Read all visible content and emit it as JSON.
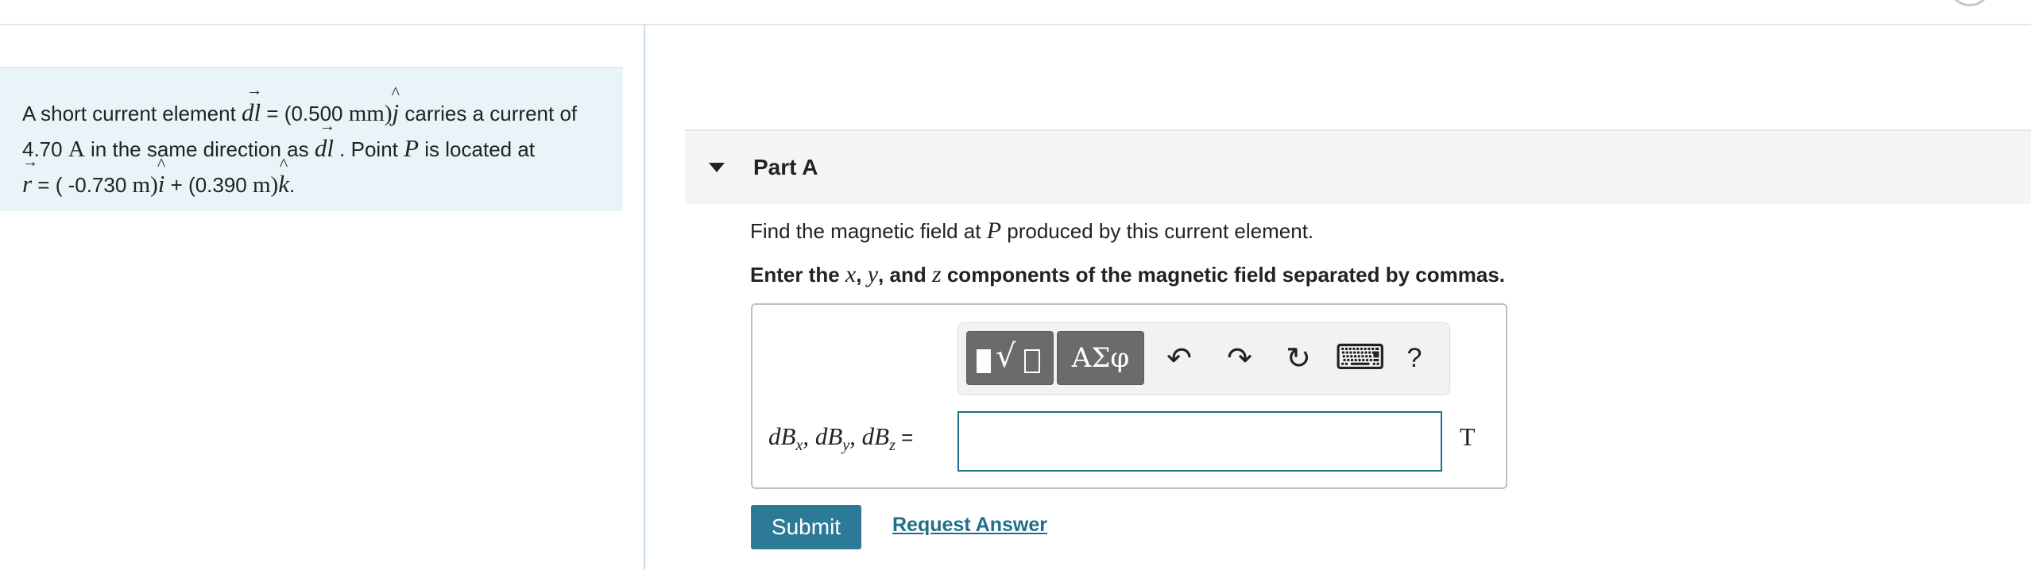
{
  "problem": {
    "text_1": "A short current element ",
    "dl_symbol": "dl",
    "text_2": " = (0.500 ",
    "unit_mm": "mm",
    "text_3": ")",
    "unit_vec_j": "j",
    "text_4": " carries a current of",
    "current_value": "4.70 ",
    "unit_A": "A",
    "text_5": " in the same direction as ",
    "text_6": " . Point ",
    "point_P": "P",
    "text_7": " is located at",
    "r_symbol": "r",
    "text_8": " = ( -0.730 ",
    "unit_m": "m",
    "text_9": ")",
    "unit_vec_i": "i",
    "text_10": " + (0.390 ",
    "text_11": ")",
    "unit_vec_k": "k",
    "text_12": "."
  },
  "part": {
    "title": "Part A",
    "prompt_1": "Find the magnetic field at ",
    "prompt_P": "P",
    "prompt_2": " produced by this current element.",
    "instruction_1": "Enter the ",
    "x": "x",
    "sep_1": ", ",
    "y": "y",
    "sep_2": ", and ",
    "z": "z",
    "instruction_2": " components of the magnetic field separated by commas."
  },
  "toolbar": {
    "templates_icon": "templates-icon",
    "greek_label": "ΑΣφ",
    "undo_icon": "↶",
    "redo_icon": "↷",
    "reset_icon": "↻",
    "keyboard_icon": "⌨",
    "help_label": "?"
  },
  "answer": {
    "label": "dBₓ, dB_y, dB_z",
    "label_dBx": "dBx",
    "label_dBy": "dBy",
    "label_dBz": "dBz",
    "equals": " =",
    "value": "",
    "units_label": "T"
  },
  "actions": {
    "submit_label": "Submit",
    "request_label": "Request Answer"
  },
  "colors": {
    "accent": "#2d7a98",
    "problem_bg": "#e8f4f7",
    "link": "#1f6f8b"
  }
}
